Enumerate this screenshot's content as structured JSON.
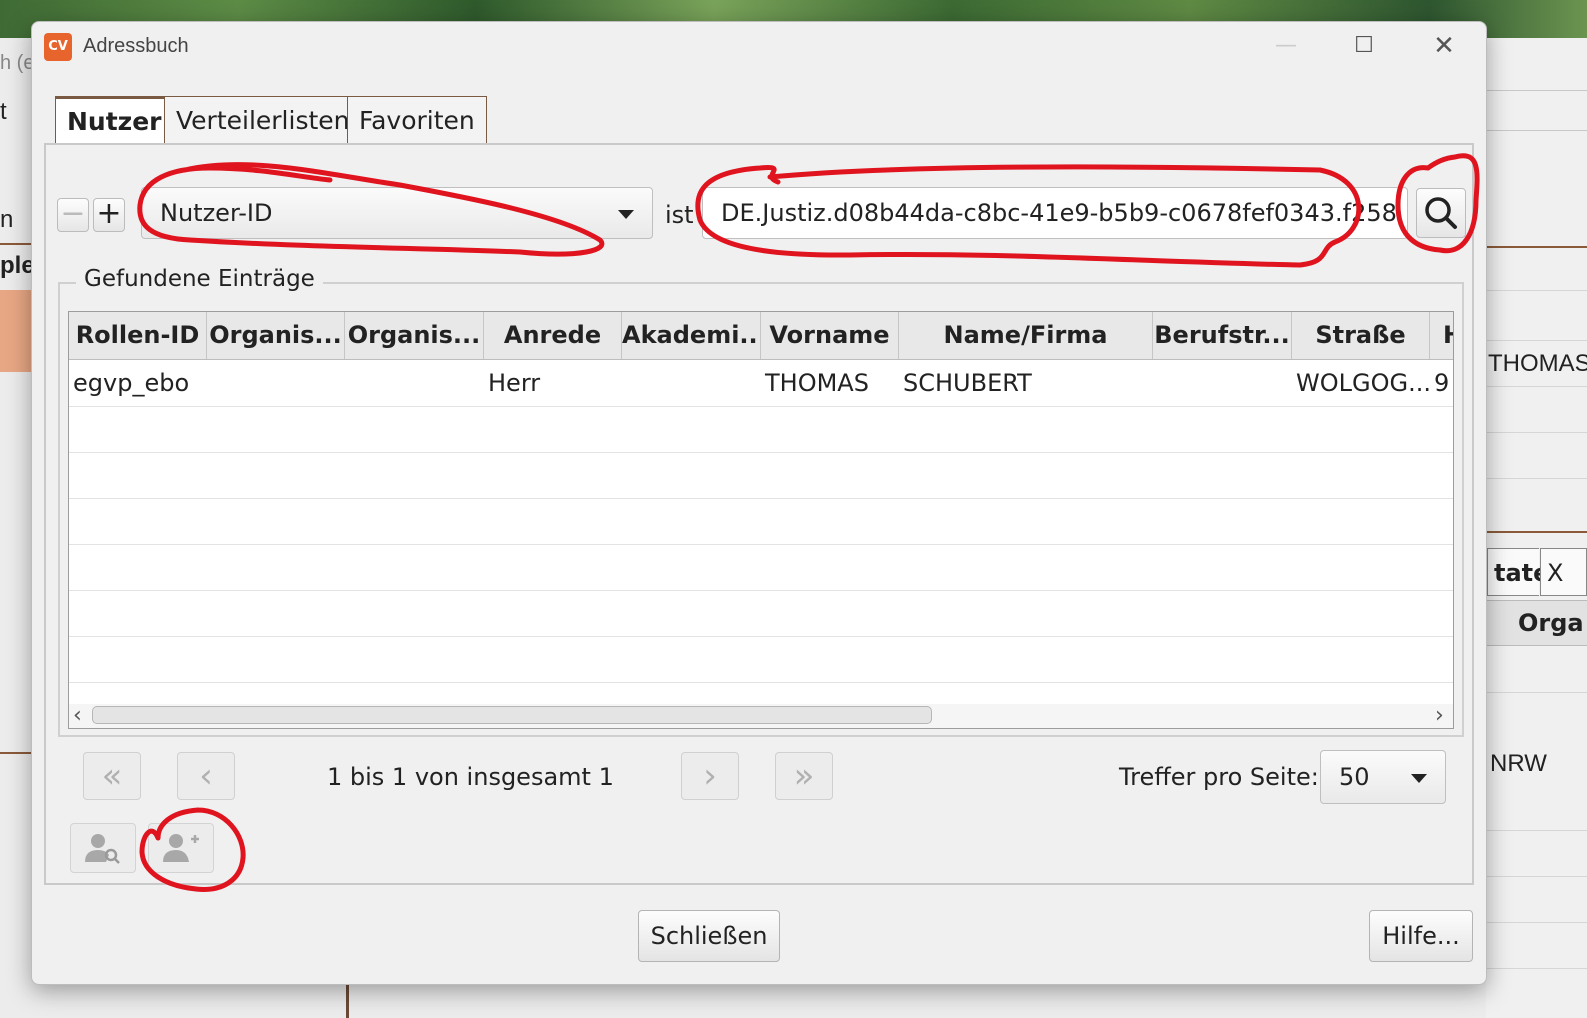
{
  "background": {
    "left_fragments": [
      "h (e",
      "t",
      "n",
      "ple"
    ],
    "right_fragments": [
      "THOMAS",
      "NRW"
    ],
    "right_tabs": [
      "tate",
      "X"
    ],
    "right_header": "Orga"
  },
  "window": {
    "icon_text": "CV",
    "title": "Adressbuch",
    "min_glyph": "—",
    "max_glyph": "☐",
    "close_glyph": "✕"
  },
  "tabs": [
    {
      "label": "Nutzer",
      "active": true
    },
    {
      "label": "Verteilerlisten",
      "active": false
    },
    {
      "label": "Favoriten",
      "active": false
    }
  ],
  "filter": {
    "remove_glyph": "−",
    "add_glyph": "+",
    "field": "Nutzer-ID",
    "operator": "ist",
    "value": "DE.Justiz.d08b44da-c8bc-41e9-b5b9-c0678fef0343.f258"
  },
  "results": {
    "group_title": "Gefundene Einträge",
    "columns": [
      "Rollen-ID",
      "Organis...",
      "Organis...",
      "Anrede",
      "Akademi...",
      "Vorname",
      "Name/Firma",
      "Berufstr...",
      "Straße",
      "H"
    ],
    "rows": [
      [
        "egvp_ebo",
        "",
        "",
        "Herr",
        "",
        "THOMAS",
        "SCHUBERT",
        "",
        "WOLGOG...",
        "9"
      ]
    ]
  },
  "pager": {
    "first_glyph": "«",
    "prev_glyph": "‹",
    "next_glyph": "›",
    "last_glyph": "»",
    "info": "1 bis 1 von insgesamt 1",
    "per_page_label": "Treffer pro Seite:",
    "per_page_value": "50"
  },
  "buttons": {
    "close": "Schließen",
    "help": "Hilfe..."
  },
  "colors": {
    "annotation": "#e0141e",
    "app_icon": "#e8642d",
    "tab_border": "#7b5a44"
  }
}
